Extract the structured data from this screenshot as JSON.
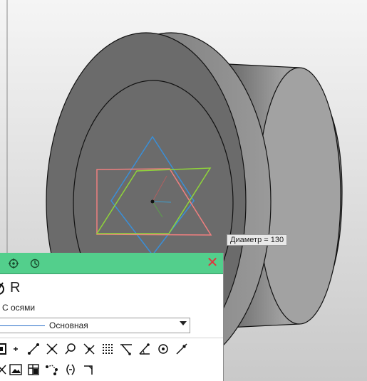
{
  "tooltip": {
    "text": "Диаметр = 130"
  },
  "panel": {
    "type_label": "R",
    "axes_label": "С осями",
    "line_style": "Основная",
    "icons": {
      "header": [
        "settings-gear-icon",
        "circle-gear-icon"
      ],
      "close": "close-icon",
      "toolbar_row1": [
        "snap-grid-icon",
        "point-icon",
        "line-segment-icon",
        "intersection-icon",
        "circle-point-icon",
        "tangent-icon",
        "grid-points-icon",
        "angle-line-icon",
        "angle-icon",
        "circle-center-icon",
        "pick-icon"
      ],
      "toolbar_row2": [
        "cut-icon",
        "image-icon",
        "table-icon",
        "polyline-points-icon",
        "arc-pair-icon",
        "corner-icon"
      ]
    }
  },
  "colors": {
    "panel_header": "#53cf8c",
    "close": "#e0343d",
    "plane_blue": "#3a8fd8",
    "plane_red": "#f07f7f",
    "plane_green": "#8fd43a"
  }
}
